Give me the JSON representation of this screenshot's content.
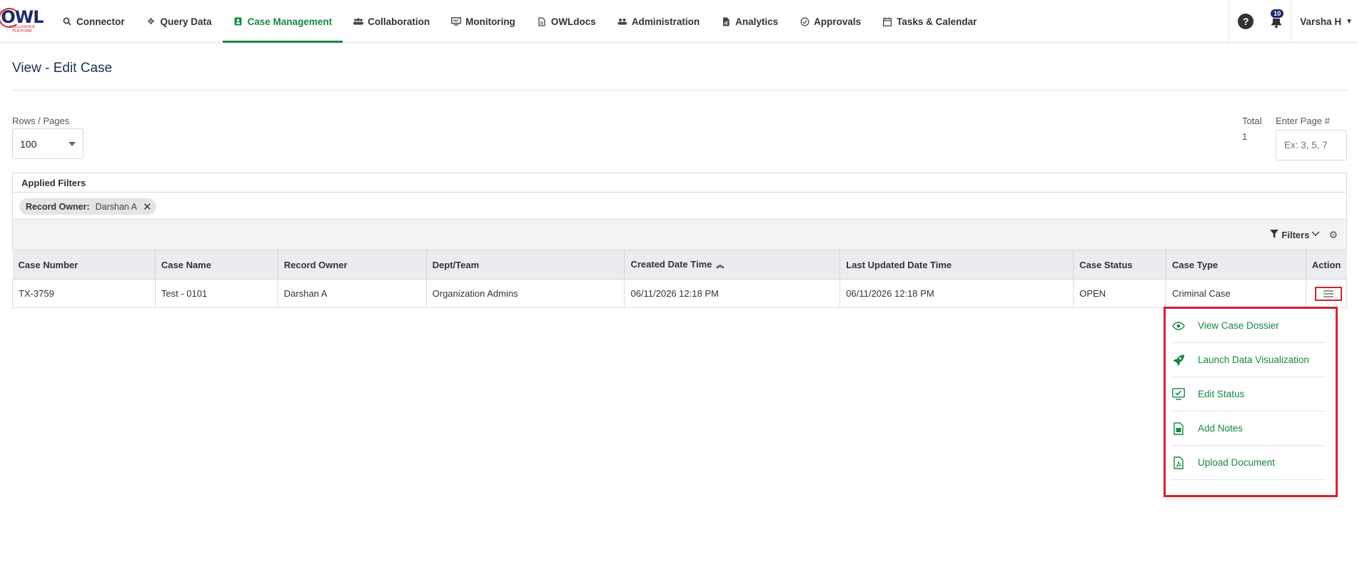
{
  "logo": {
    "text": "OWL",
    "subtext": "INTELLIGENCE PLATFORM"
  },
  "nav": {
    "items": [
      {
        "label": "Connector",
        "icon": "search-icon"
      },
      {
        "label": "Query Data",
        "icon": "arrows-icon"
      },
      {
        "label": "Case Management",
        "icon": "user-badge-icon",
        "active": true
      },
      {
        "label": "Collaboration",
        "icon": "people-icon"
      },
      {
        "label": "Monitoring",
        "icon": "monitor-icon"
      },
      {
        "label": "OWLdocs",
        "icon": "document-icon"
      },
      {
        "label": "Administration",
        "icon": "users-gear-icon"
      },
      {
        "label": "Analytics",
        "icon": "file-chart-icon"
      },
      {
        "label": "Approvals",
        "icon": "approval-icon"
      },
      {
        "label": "Tasks & Calendar",
        "icon": "calendar-icon"
      }
    ],
    "notifications_count": "10",
    "user_name": "Varsha H"
  },
  "page": {
    "title": "View - Edit Case",
    "rows_label": "Rows / Pages",
    "rows_value": "100",
    "total_label": "Total",
    "total_value": "1",
    "page_label": "Enter Page #",
    "page_placeholder": "Ex: 3, 5, 7"
  },
  "applied_filters": {
    "title": "Applied Filters",
    "chips": [
      {
        "key": "Record Owner:",
        "value": "Darshan A"
      }
    ]
  },
  "toolbar": {
    "filters_label": "Filters"
  },
  "table": {
    "columns": [
      "Case Number",
      "Case Name",
      "Record Owner",
      "Dept/Team",
      "Created Date Time",
      "Last Updated Date Time",
      "Case Status",
      "Case Type",
      "Action"
    ],
    "rows": [
      [
        "TX-3759",
        "Test - 0101",
        "Darshan A",
        "Organization Admins",
        "06/11/2026 12:18 PM",
        "06/11/2026 12:18 PM",
        "OPEN",
        "Criminal Case"
      ]
    ]
  },
  "action_menu": {
    "items": [
      {
        "label": "View Case Dossier",
        "icon": "eye-icon"
      },
      {
        "label": "Launch Data Visualization",
        "icon": "rocket-icon"
      },
      {
        "label": "Edit Status",
        "icon": "edit-status-icon"
      },
      {
        "label": "Add Notes",
        "icon": "notes-icon"
      },
      {
        "label": "Upload Document",
        "icon": "pdf-icon"
      }
    ]
  },
  "colors": {
    "accent": "#14893f",
    "highlight": "#d0252f",
    "title": "#1f2f56"
  }
}
